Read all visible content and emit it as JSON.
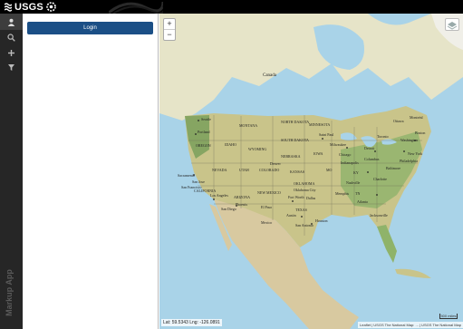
{
  "header": {
    "logo_text": "USGS"
  },
  "sidebar": {
    "app_label": "Markup App"
  },
  "panel": {
    "login_label": "Login"
  },
  "map": {
    "coordinates": "Lat: 59.5343 Lng: -126.0891",
    "attribution": "Leaflet | USGS The National Map: ... | USGS The National Map",
    "scale": "500 miles",
    "labels": {
      "canada": "Canada",
      "seattle": "Seattle",
      "portland": "Portland",
      "oregon": "OREGON",
      "idaho": "IDAHO",
      "montana": "MONTANA",
      "wyoming": "WYOMING",
      "nevada": "NEVADA",
      "utah": "UTAH",
      "colorado": "COLORADO",
      "california": "CALIFORNIA",
      "sacramento": "Sacramento",
      "san_francisco": "San Francisco",
      "san_jose": "San Jose",
      "los_angeles": "Los Angeles",
      "san_diego": "San Diego",
      "phoenix": "Phoenix",
      "arizona": "ARIZONA",
      "new_mexico": "NEW MEXICO",
      "el_paso": "El Paso",
      "denver": "Denver",
      "north_dakota": "NORTH DAKOTA",
      "south_dakota": "SOUTH DAKOTA",
      "nebraska": "NEBRASKA",
      "kansas": "KANSAS",
      "oklahoma": "OKLAHOMA",
      "oklahoma_city": "Oklahoma City",
      "texas": "TEXAS",
      "dallas": "Dallas",
      "fort_worth": "Fort Worth",
      "austin": "Austin",
      "san_antonio": "San Antonio",
      "houston": "Houston",
      "minnesota": "MINNESOTA",
      "saint_paul": "Saint Paul",
      "iowa": "IOWA",
      "missouri": "MO",
      "milwaukee": "Milwaukee",
      "chicago": "Chicago",
      "detroit": "Detroit",
      "columbus": "Columbus",
      "indianapolis": "Indianapolis",
      "memphis": "Memphis",
      "nashville": "Nashville",
      "charlotte": "Charlotte",
      "atlanta": "Atlanta",
      "jacksonville": "Jacksonville",
      "washington": "Washington",
      "new_york": "New York",
      "boston": "Boston",
      "toronto": "Toronto",
      "ottawa": "Ottawa",
      "montreal": "Montréal",
      "kentucky": "KY",
      "tennessee": "TN",
      "baltimore": "Baltimore",
      "philadelphia": "Philadelphia",
      "mexico": "Mexico"
    }
  }
}
